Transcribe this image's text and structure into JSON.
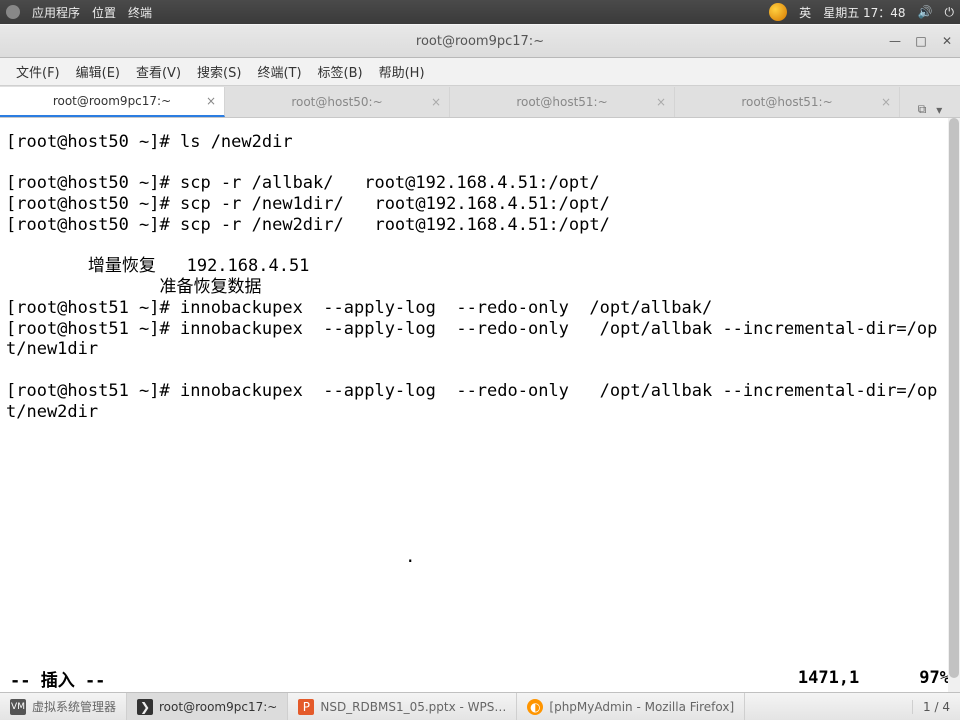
{
  "panel": {
    "apps": "应用程序",
    "places": "位置",
    "terminal": "终端",
    "lang": "英",
    "date": "星期五 17：48"
  },
  "window": {
    "title": "root@room9pc17:~"
  },
  "menu": {
    "file": "文件(F)",
    "edit": "编辑(E)",
    "view": "查看(V)",
    "search": "搜索(S)",
    "terminal": "终端(T)",
    "tabs": "标签(B)",
    "help": "帮助(H)"
  },
  "tabs": [
    {
      "label": "root@room9pc17:~",
      "active": true
    },
    {
      "label": "root@host50:~",
      "active": false
    },
    {
      "label": "root@host51:~",
      "active": false
    },
    {
      "label": "root@host51:~",
      "active": false
    }
  ],
  "terminal_lines": [
    "[root@host50 ~]# ls /new2dir",
    "",
    "[root@host50 ~]# scp -r /allbak/   root@192.168.4.51:/opt/",
    "[root@host50 ~]# scp -r /new1dir/   root@192.168.4.51:/opt/",
    "[root@host50 ~]# scp -r /new2dir/   root@192.168.4.51:/opt/",
    "",
    "        增量恢复   192.168.4.51",
    "               准备恢复数据",
    "[root@host51 ~]# innobackupex  --apply-log  --redo-only  /opt/allbak/",
    "[root@host51 ~]# innobackupex  --apply-log  --redo-only   /opt/allbak --incremental-dir=/opt/new1dir",
    "",
    "[root@host51 ~]# innobackupex  --apply-log  --redo-only   /opt/allbak --incremental-dir=/opt/new2dir",
    "",
    "",
    "",
    "",
    "",
    "",
    "                                       .",
    "",
    "",
    "",
    ""
  ],
  "status": {
    "mode": "-- 插入 --",
    "pos": "1471,1",
    "pct": "97%"
  },
  "taskbar": {
    "vm": "虚拟系统管理器",
    "term": "root@room9pc17:~",
    "wps": "NSD_RDBMS1_05.pptx - WPS…",
    "ff": "[phpMyAdmin - Mozilla Firefox]",
    "ws": "1 / 4"
  }
}
